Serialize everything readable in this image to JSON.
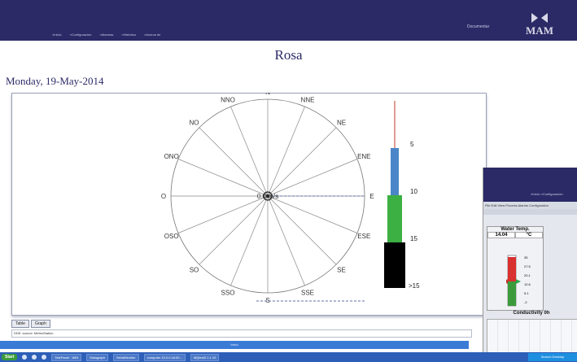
{
  "header": {
    "nav": [
      "»Inicio",
      "»Configuración",
      "»Alarmas",
      "»Histórico",
      "»Acerca de"
    ],
    "doc_link": "Documentar",
    "logo_text": "MAM"
  },
  "page": {
    "title": "Rosa",
    "date": "Monday, 19-May-2014"
  },
  "rose": {
    "directions": [
      "N",
      "NNE",
      "NE",
      "ENE",
      "E",
      "ESE",
      "SE",
      "SSE",
      "S",
      "SSO",
      "SO",
      "OSO",
      "O",
      "ONO",
      "NO",
      "NNO"
    ],
    "center_value": "0.0 m/s"
  },
  "gauge": {
    "ticks": [
      "5",
      "10",
      "15",
      ">15"
    ],
    "colors": {
      "blue": "#4a86c8",
      "green": "#3cb043",
      "black": "#000000",
      "line": "#c0392b"
    }
  },
  "bottom": {
    "tabs": [
      "Table",
      "Graph"
    ],
    "status_text": "DDE: source: MeteoStation",
    "bluebar_text": "Inicio"
  },
  "taskbar": {
    "start": "Start",
    "tasks": [
      "TelePanel - WIN",
      "Datagraph",
      "SerialMonitor",
      "computer 10.0.0.44:90...",
      "MQtest2.1.1.10"
    ],
    "tray": "Search Desktop"
  },
  "overlay": {
    "nav": "»Inicio  »Configuración",
    "menu": "File  Edit  View  Process  Alarms  Configuration",
    "water_temp_label": "Water Temp.",
    "water_temp_value": "14.04",
    "water_temp_unit": "°C",
    "scale": [
      "35",
      "27.5",
      "20.1",
      "12.6",
      "5.1",
      "-2"
    ],
    "conductivity_label": "Conductivity 0h"
  }
}
